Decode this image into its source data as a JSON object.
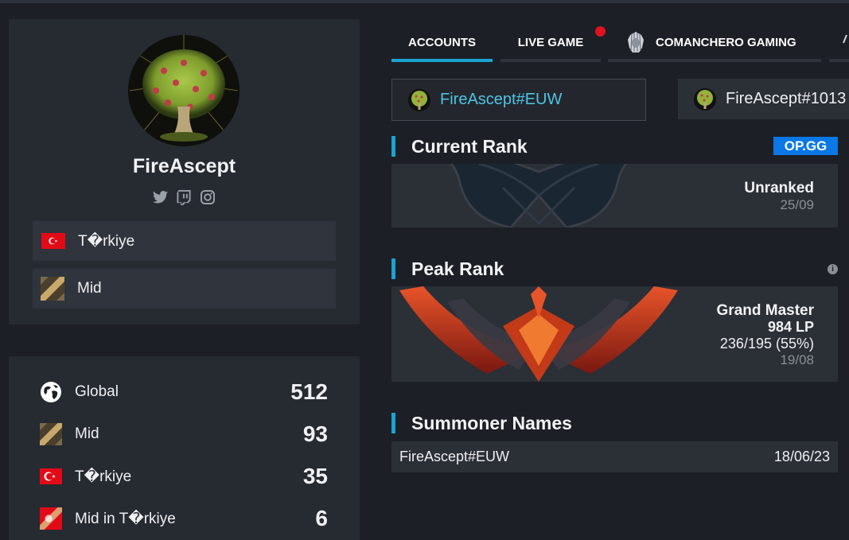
{
  "profile": {
    "name": "FireAscept",
    "country": "T�rkiye",
    "role": "Mid",
    "socials": [
      "twitter-icon",
      "twitch-icon",
      "instagram-icon"
    ]
  },
  "stats": [
    {
      "icon": "globe-icon",
      "label": "Global",
      "value": "512"
    },
    {
      "icon": "mid-role-icon",
      "label": "Mid",
      "value": "93"
    },
    {
      "icon": "turkey-flag-icon",
      "label": "T�rkiye",
      "value": "35"
    },
    {
      "icon": "mid-turkey-icon",
      "label": "Mid in T�rkiye",
      "value": "6"
    }
  ],
  "tabs": [
    {
      "label": "ACCOUNTS",
      "active": true
    },
    {
      "label": "LIVE GAME",
      "active": false
    },
    {
      "label": "COMANCHERO GAMING",
      "active": false
    }
  ],
  "accounts": [
    {
      "name": "FireAscept#EUW",
      "selected": true
    },
    {
      "name": "FireAscept#1013",
      "selected": false
    }
  ],
  "current_rank": {
    "title": "Current Rank",
    "badge": "OP.GG",
    "tier": "Unranked",
    "date": "25/09"
  },
  "peak_rank": {
    "title": "Peak Rank",
    "tier": "Grand Master",
    "lp": "984 LP",
    "record": "236/195 (55%)",
    "date": "19/08"
  },
  "summoner_names": {
    "title": "Summoner Names",
    "rows": [
      {
        "name": "FireAscept#EUW",
        "date": "18/06/23"
      }
    ]
  },
  "colors": {
    "accent": "#1aa3d1",
    "live": "#e0121f",
    "opgg": "#0a78e6",
    "selected_account_text": "#4fc3e3"
  }
}
